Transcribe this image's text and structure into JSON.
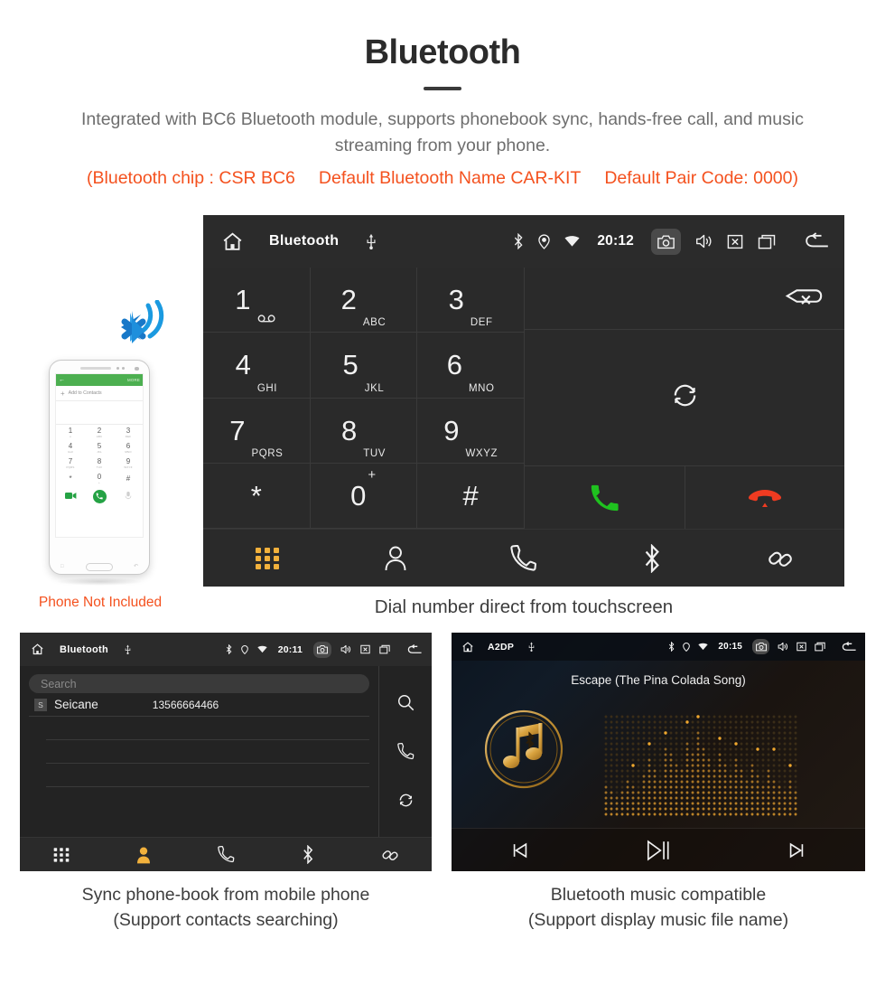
{
  "header": {
    "title": "Bluetooth",
    "subtitle": "Integrated with BC6 Bluetooth module, supports phonebook sync, hands-free call, and music streaming from your phone.",
    "specs": [
      "(Bluetooth chip : CSR BC6",
      "Default Bluetooth Name CAR-KIT",
      "Default Pair Code: 0000)"
    ],
    "accent_color": "#f4511e",
    "text_color": "#6e6e6e"
  },
  "dialer": {
    "statusbar": {
      "home_icon": "home-icon",
      "title": "Bluetooth",
      "usb_icon": "usb-icon",
      "bluetooth_icon": "bluetooth-icon",
      "location_icon": "location-pin-icon",
      "wifi_icon": "wifi-icon",
      "time": "20:12",
      "camera_icon": "camera-icon",
      "volume_icon": "volume-icon",
      "mute_icon": "mute-icon",
      "recents_icon": "recents-icon",
      "back_icon": "back-icon"
    },
    "keys": [
      {
        "digit": "1",
        "letters": "",
        "icon": "voicemail-icon"
      },
      {
        "digit": "2",
        "letters": "ABC",
        "icon": ""
      },
      {
        "digit": "3",
        "letters": "DEF",
        "icon": ""
      },
      {
        "digit": "4",
        "letters": "GHI",
        "icon": ""
      },
      {
        "digit": "5",
        "letters": "JKL",
        "icon": ""
      },
      {
        "digit": "6",
        "letters": "MNO",
        "icon": ""
      },
      {
        "digit": "7",
        "letters": "PQRS",
        "icon": ""
      },
      {
        "digit": "8",
        "letters": "TUV",
        "icon": ""
      },
      {
        "digit": "9",
        "letters": "WXYZ",
        "icon": ""
      },
      {
        "digit": "*",
        "letters": "",
        "icon": ""
      },
      {
        "digit": "0",
        "letters": "+",
        "icon": ""
      },
      {
        "digit": "#",
        "letters": "",
        "icon": ""
      }
    ],
    "number_value": "",
    "backspace_icon": "backspace-icon",
    "sync_icon": "sync-icon",
    "answer_icon": "call-answer-icon",
    "hangup_icon": "call-hangup-icon",
    "answer_color": "#1fc11f",
    "hangup_color": "#ef3b21",
    "nav": [
      {
        "icon": "keypad-icon",
        "active": true
      },
      {
        "icon": "contacts-icon",
        "active": false
      },
      {
        "icon": "call-log-icon",
        "active": false
      },
      {
        "icon": "bluetooth-icon",
        "active": false
      },
      {
        "icon": "link-icon",
        "active": false
      }
    ],
    "active_color": "#f2b13c",
    "caption": "Dial number direct from touchscreen"
  },
  "phone_mockup": {
    "topbar_back_icon": "back-arrow-icon",
    "topbar_more_label": "MORE",
    "add_contact_label": "Add to Contacts",
    "keys": [
      {
        "d": "1",
        "s": "∞"
      },
      {
        "d": "2",
        "s": "ABC"
      },
      {
        "d": "3",
        "s": "DEF"
      },
      {
        "d": "4",
        "s": "GHI"
      },
      {
        "d": "5",
        "s": "JKL"
      },
      {
        "d": "6",
        "s": "MNO"
      },
      {
        "d": "7",
        "s": "PQRS"
      },
      {
        "d": "8",
        "s": "TUV"
      },
      {
        "d": "9",
        "s": "WXYZ"
      },
      {
        "d": "*",
        "s": ""
      },
      {
        "d": "0",
        "s": "+"
      },
      {
        "d": "#",
        "s": ""
      }
    ],
    "video_call_icon": "video-call-icon",
    "call_icon": "call-icon",
    "keyboard_icon": "keyboard-icon",
    "bluetooth_signal_icon": "bluetooth-signal-icon",
    "caption": "Phone Not Included",
    "caption_color": "#f4511e"
  },
  "phonebook": {
    "statusbar": {
      "home_icon": "home-icon",
      "title": "Bluetooth",
      "usb_icon": "usb-icon",
      "time": "20:11",
      "camera_icon": "camera-icon"
    },
    "search_placeholder": "Search",
    "contacts": [
      {
        "badge": "S",
        "name": "Seicane",
        "number": "13566664466"
      }
    ],
    "empty_rows": 3,
    "side_actions": [
      {
        "icon": "search-icon"
      },
      {
        "icon": "call-icon"
      },
      {
        "icon": "sync-icon"
      }
    ],
    "nav": [
      {
        "icon": "keypad-icon",
        "active": false
      },
      {
        "icon": "contacts-icon",
        "active": true
      },
      {
        "icon": "call-log-icon",
        "active": false
      },
      {
        "icon": "bluetooth-icon",
        "active": false
      },
      {
        "icon": "link-icon",
        "active": false
      }
    ],
    "caption_line1": "Sync phone-book from mobile phone",
    "caption_line2": "(Support contacts searching)"
  },
  "music": {
    "statusbar": {
      "home_icon": "home-icon",
      "title": "A2DP",
      "usb_icon": "usb-icon",
      "time": "20:15",
      "camera_icon": "camera-icon"
    },
    "track_title": "Escape (The Pina Colada Song)",
    "album_icon": "music-note-bluetooth-icon",
    "equalizer": "dot-matrix-equalizer",
    "controls": [
      {
        "icon": "previous-track-icon"
      },
      {
        "icon": "play-pause-icon"
      },
      {
        "icon": "next-track-icon"
      }
    ],
    "accent_color": "#d99a2b",
    "caption_line1": "Bluetooth music compatible",
    "caption_line2": "(Support display music file name)"
  }
}
